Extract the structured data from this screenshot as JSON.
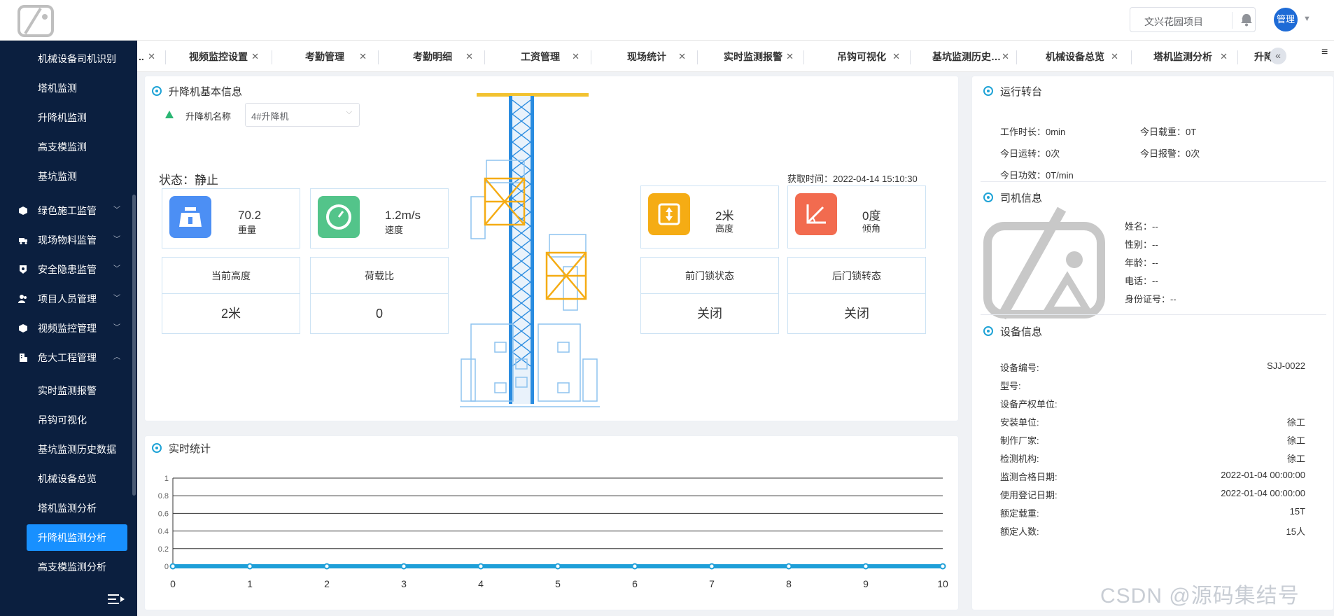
{
  "header": {
    "project": "文兴花园项目",
    "avatar_text": "管理"
  },
  "sidebar": {
    "items": [
      {
        "label": "机械设备司机识别"
      },
      {
        "label": "塔机监测"
      },
      {
        "label": "升降机监测"
      },
      {
        "label": "高支模监测"
      },
      {
        "label": "基坑监测"
      },
      {
        "label": "绿色施工监管"
      },
      {
        "label": "现场物料监管"
      },
      {
        "label": "安全隐患监管"
      },
      {
        "label": "项目人员管理"
      },
      {
        "label": "视频监控管理"
      },
      {
        "label": "危大工程管理"
      },
      {
        "label": "实时监测报警"
      },
      {
        "label": "吊钩可视化"
      },
      {
        "label": "基坑监测历史数据"
      },
      {
        "label": "机械设备总览"
      },
      {
        "label": "塔机监测分析"
      },
      {
        "label": "升降机监测分析"
      },
      {
        "label": "高支模监测分析"
      }
    ]
  },
  "tabs": [
    {
      "label": ".."
    },
    {
      "label": "视频监控设置"
    },
    {
      "label": "考勤管理"
    },
    {
      "label": "考勤明细"
    },
    {
      "label": "工资管理"
    },
    {
      "label": "现场统计"
    },
    {
      "label": "实时监测报警"
    },
    {
      "label": "吊钩可视化"
    },
    {
      "label": "基坑监测历史…"
    },
    {
      "label": "机械设备总览"
    },
    {
      "label": "塔机监测分析"
    },
    {
      "label": "升降"
    }
  ],
  "basic": {
    "title": "升降机基本信息",
    "name_label": "升降机名称",
    "name_value": "4#升降机",
    "state": "状态：静止",
    "get_time": "获取时间：2022-04-14 15:10:30",
    "cards": [
      {
        "value": "70.2",
        "unit": "重量"
      },
      {
        "value": "1.2m/s",
        "unit": "速度"
      },
      {
        "value": "2米",
        "unit": "高度"
      },
      {
        "value": "0度",
        "unit": "倾角"
      }
    ],
    "cells": [
      {
        "head": "当前高度",
        "value": "2米"
      },
      {
        "head": "荷载比",
        "value": "0"
      },
      {
        "head": "前门锁状态",
        "value": "关闭"
      },
      {
        "head": "后门锁转态",
        "value": "关闭"
      }
    ]
  },
  "stats": {
    "title": "实时统计"
  },
  "chart_data": {
    "type": "line",
    "x": [
      0,
      1,
      2,
      3,
      4,
      5,
      6,
      7,
      8,
      9,
      10
    ],
    "series": [
      {
        "values": [
          0,
          0,
          0,
          0,
          0,
          0,
          0,
          0,
          0,
          0,
          0
        ]
      }
    ],
    "xlim": [
      0,
      10
    ],
    "ylim": [
      0,
      1
    ],
    "yticks": [
      "0",
      "0.2",
      "0.4",
      "0.6",
      "0.8",
      "1"
    ],
    "xticks": [
      "0",
      "1",
      "2",
      "3",
      "4",
      "5",
      "6",
      "7",
      "8",
      "9",
      "10"
    ],
    "grid": true,
    "color": "#1e9fd8"
  },
  "run": {
    "title": "运行转台",
    "work_time": "工作时长：0min",
    "today_load": "今日载重：0T",
    "today_runs": "今日运转：0次",
    "today_alarms": "今日报警：0次",
    "today_work": "今日功效：0T/min"
  },
  "driver": {
    "title": "司机信息",
    "name": "姓名：--",
    "gender": "性别：--",
    "age": "年龄：--",
    "phone": "电话：--",
    "id": "身份证号：--"
  },
  "device": {
    "title": "设备信息",
    "rows": [
      {
        "k": "设备编号:",
        "v": "SJJ-0022"
      },
      {
        "k": "型号:",
        "v": ""
      },
      {
        "k": "设备产权单位:",
        "v": ""
      },
      {
        "k": "安装单位:",
        "v": "徐工"
      },
      {
        "k": "制作厂家:",
        "v": "徐工"
      },
      {
        "k": "检测机构:",
        "v": "徐工"
      },
      {
        "k": "监测合格日期:",
        "v": "2022-01-04 00:00:00"
      },
      {
        "k": "使用登记日期:",
        "v": "2022-01-04 00:00:00"
      },
      {
        "k": "额定载重:",
        "v": "15T"
      },
      {
        "k": "额定人数:",
        "v": "15人"
      }
    ]
  },
  "watermark": "CSDN @源码集结号"
}
